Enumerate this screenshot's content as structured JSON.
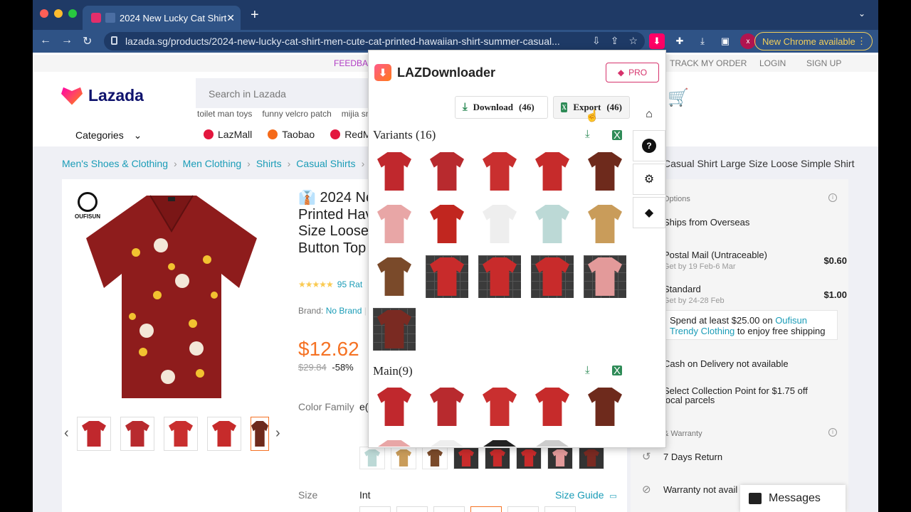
{
  "browser": {
    "tab_title": "2024 New Lucky Cat Shirt",
    "url": "lazada.sg/products/2024-new-lucky-cat-shirt-men-cute-cat-printed-hawaiian-shirt-summer-casual...",
    "new_chrome": "New Chrome available",
    "profile_initial": "x"
  },
  "topbar": {
    "feedback": "FEEDBAC",
    "track": "TRACK MY ORDER",
    "login": "LOGIN",
    "signup": "SIGN UP"
  },
  "header": {
    "logo": "Lazada",
    "search_placeholder": "Search in Lazada",
    "hints": [
      "toilet man toys",
      "funny velcro patch",
      "mijia sma"
    ],
    "categories": "Categories",
    "malls": [
      {
        "label": "LazMall",
        "color": "#e3173e"
      },
      {
        "label": "Taobao",
        "color": "#f56a1a"
      },
      {
        "label": "RedMa",
        "color": "#e3173e"
      }
    ]
  },
  "breadcrumb": {
    "items": [
      "Men's Shoes & Clothing",
      "Men Clothing",
      "Shirts",
      "Casual Shirts"
    ],
    "tail": "Casual Shirt Large Size Loose Simple Shirt"
  },
  "product": {
    "brand_mark": "OUFISUN",
    "title_lines": [
      "2024 Ne",
      "Printed Hav",
      "Size Loose",
      "Button Top"
    ],
    "ratings": "95 Rat",
    "brand_label": "Brand:",
    "brand_value": "No Brand",
    "price": "$12.62",
    "old_price": "$29.84",
    "discount": "-58%",
    "color_family_label": "Color Family",
    "color_family_value": "e(",
    "size_label": "Size",
    "size_value": "Int",
    "size_guide": "Size Guide"
  },
  "delivery": {
    "options_header": "Options",
    "ships_from": "Ships from Overseas",
    "postal_name": "Postal Mail (Untraceable)",
    "postal_date": "Get by 19 Feb-6 Mar",
    "postal_price": "$0.60",
    "standard_name": "Standard",
    "standard_date": "Get by 24-28 Feb",
    "standard_price": "$1.00",
    "spend_prefix": "Spend at least $25.00 on",
    "spend_store": "Oufisun Trendy Clothing",
    "spend_suffix": "to enjoy free shipping",
    "cod": "Cash on Delivery not available",
    "collection": "Select Collection Point for $1.75 off",
    "collection_sub": "local parcels",
    "warranty_header": "& Warranty",
    "returns": "7 Days Return",
    "warranty": "Warranty not avail",
    "messages": "Messages"
  },
  "extension": {
    "name": "LAZDownloader",
    "pro": "PRO",
    "download_label": "Download",
    "download_count": "(46)",
    "export_label": "Export",
    "export_count": "(46)",
    "variants_title": "Variants",
    "variants_count": "(16)",
    "main_title": "Main(9)",
    "variant_colors": [
      "#c0282d",
      "#b82a2e",
      "#c92f2f",
      "#c62b2b",
      "#6e2a1c",
      "#e8a6a6",
      "#c1261f",
      "#eeeeee",
      "#bcd9d6",
      "#c99c5a",
      "#7a4a2a",
      "#c82b2b",
      "#c82b2b",
      "#c82b2b",
      "#e39a9a",
      "#7a2a22"
    ],
    "main_colors": [
      "#c0282d",
      "#b82a2e",
      "#c92f2f",
      "#c62b2b",
      "#6e2a1c",
      "#e8a6a6",
      "#eeeeee",
      "#222222",
      "#cccccc"
    ]
  }
}
